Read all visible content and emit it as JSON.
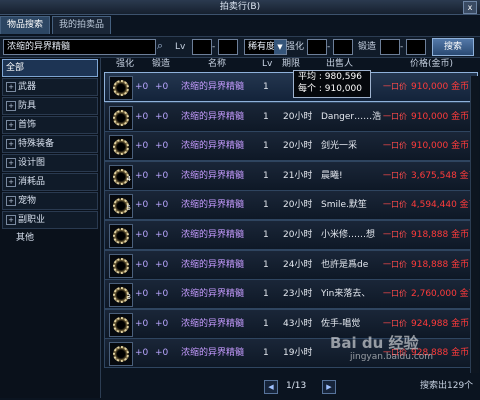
{
  "window": {
    "title": "拍卖行(B)",
    "close": "x"
  },
  "tabs": [
    "物品搜索",
    "我的拍卖品"
  ],
  "search": {
    "value": "浓缩的异界精髓",
    "lv_label": "Lv",
    "rarity": "稀有度",
    "enhance_label": "强化",
    "forge_label": "锻造",
    "button": "搜索",
    "icon": "search-icon"
  },
  "sidebar": [
    {
      "label": "全部",
      "selected": true
    },
    {
      "label": "武器"
    },
    {
      "label": "防具"
    },
    {
      "label": "首饰"
    },
    {
      "label": "特殊装备"
    },
    {
      "label": "设计图"
    },
    {
      "label": "消耗品"
    },
    {
      "label": "宠物"
    },
    {
      "label": "副职业"
    },
    {
      "label": "其他"
    }
  ],
  "columns": {
    "enhance": "强化",
    "forge": "锻造",
    "name": "名称",
    "lv": "Lv",
    "period": "期限",
    "seller": "出售人",
    "price": "价格(金币)"
  },
  "rows": [
    {
      "count": "",
      "enhance": "+0",
      "forge": "+0",
      "name": "浓缩的异界精髓",
      "lv": "1",
      "period": "",
      "seller": "",
      "yk": "一口价",
      "price": "910,000 金币"
    },
    {
      "count": "",
      "enhance": "+0",
      "forge": "+0",
      "name": "浓缩的异界精髓",
      "lv": "1",
      "period": "20小时",
      "seller": "Danger……浩",
      "yk": "一口价",
      "price": "910,000 金币"
    },
    {
      "count": "",
      "enhance": "+0",
      "forge": "+0",
      "name": "浓缩的异界精髓",
      "lv": "1",
      "period": "20小时",
      "seller": "剑光一采",
      "yk": "一口价",
      "price": "910,000 金币"
    },
    {
      "count": "4",
      "enhance": "+0",
      "forge": "+0",
      "name": "浓缩的异界精髓",
      "lv": "1",
      "period": "21小时",
      "seller": "晨曦!",
      "yk": "一口价",
      "price": "3,675,548 金币"
    },
    {
      "count": "5",
      "enhance": "+0",
      "forge": "+0",
      "name": "浓缩的异界精髓",
      "lv": "1",
      "period": "20小时",
      "seller": "Smile.默笙",
      "yk": "一口价",
      "price": "4,594,440 金币"
    },
    {
      "count": "",
      "enhance": "+0",
      "forge": "+0",
      "name": "浓缩的异界精髓",
      "lv": "1",
      "period": "20小时",
      "seller": "小米修……想",
      "yk": "一口价",
      "price": "918,888 金币"
    },
    {
      "count": "",
      "enhance": "+0",
      "forge": "+0",
      "name": "浓缩的异界精髓",
      "lv": "1",
      "period": "24小时",
      "seller": "也許是爲de",
      "yk": "一口价",
      "price": "918,888 金币"
    },
    {
      "count": "3",
      "enhance": "+0",
      "forge": "+0",
      "name": "浓缩的异界精髓",
      "lv": "1",
      "period": "23小时",
      "seller": "Yin来落去、",
      "yk": "一口价",
      "price": "2,760,000 金币"
    },
    {
      "count": "",
      "enhance": "+0",
      "forge": "+0",
      "name": "浓缩的异界精髓",
      "lv": "1",
      "period": "43小时",
      "seller": "佐手-唱觉",
      "yk": "一口价",
      "price": "924,988 金币"
    },
    {
      "count": "",
      "enhance": "+0",
      "forge": "+0",
      "name": "浓缩的异界精髓",
      "lv": "1",
      "period": "19小时",
      "seller": "",
      "yk": "一口价",
      "price": "928,888 金币"
    }
  ],
  "tooltip": {
    "avg": "平均 : 980,596",
    "each": "每个 : 910,000"
  },
  "pager": {
    "page": "1/13",
    "count": "搜索出129个"
  },
  "watermark": {
    "main": "Bai du 经验",
    "sub": "jingyan.baidu.com"
  },
  "colors": {
    "accent": "#8fb1da",
    "price": "#ff3b3b",
    "name": "#c59bff"
  }
}
